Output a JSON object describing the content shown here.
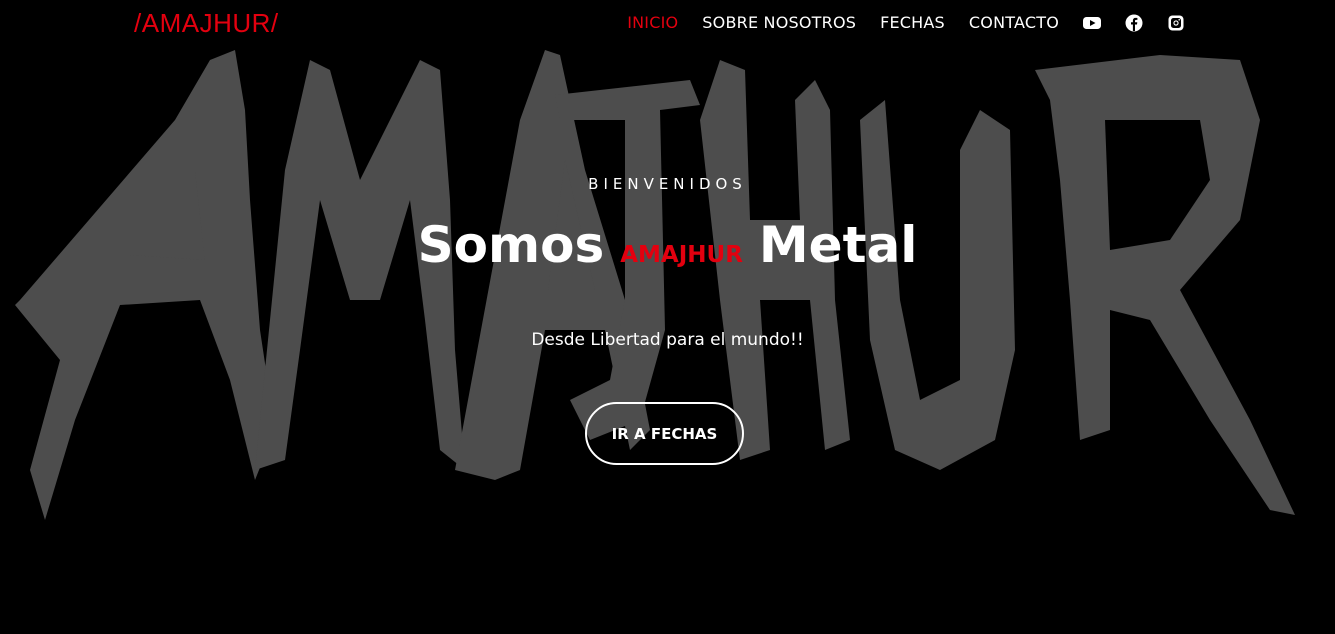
{
  "nav": {
    "brand": "/AMAJHUR/",
    "items": [
      {
        "label": "INICIO",
        "active": true
      },
      {
        "label": "SOBRE NOSOTROS",
        "active": false
      },
      {
        "label": "FECHAS",
        "active": false
      },
      {
        "label": "CONTACTO",
        "active": false
      }
    ],
    "social": [
      "youtube-icon",
      "facebook-icon",
      "instagram-icon"
    ]
  },
  "hero": {
    "welcome": "BIENVENIDOS",
    "headline_prefix": "Somos",
    "headline_brand": "AMAJHUR",
    "headline_suffix": "Metal",
    "tagline": "Desde Libertad para el mundo!!",
    "cta_label": "IR A FECHAS"
  },
  "colors": {
    "accent": "#e3000f",
    "background": "#000000",
    "logo_gray": "#4d4d4d",
    "text": "#ffffff"
  }
}
